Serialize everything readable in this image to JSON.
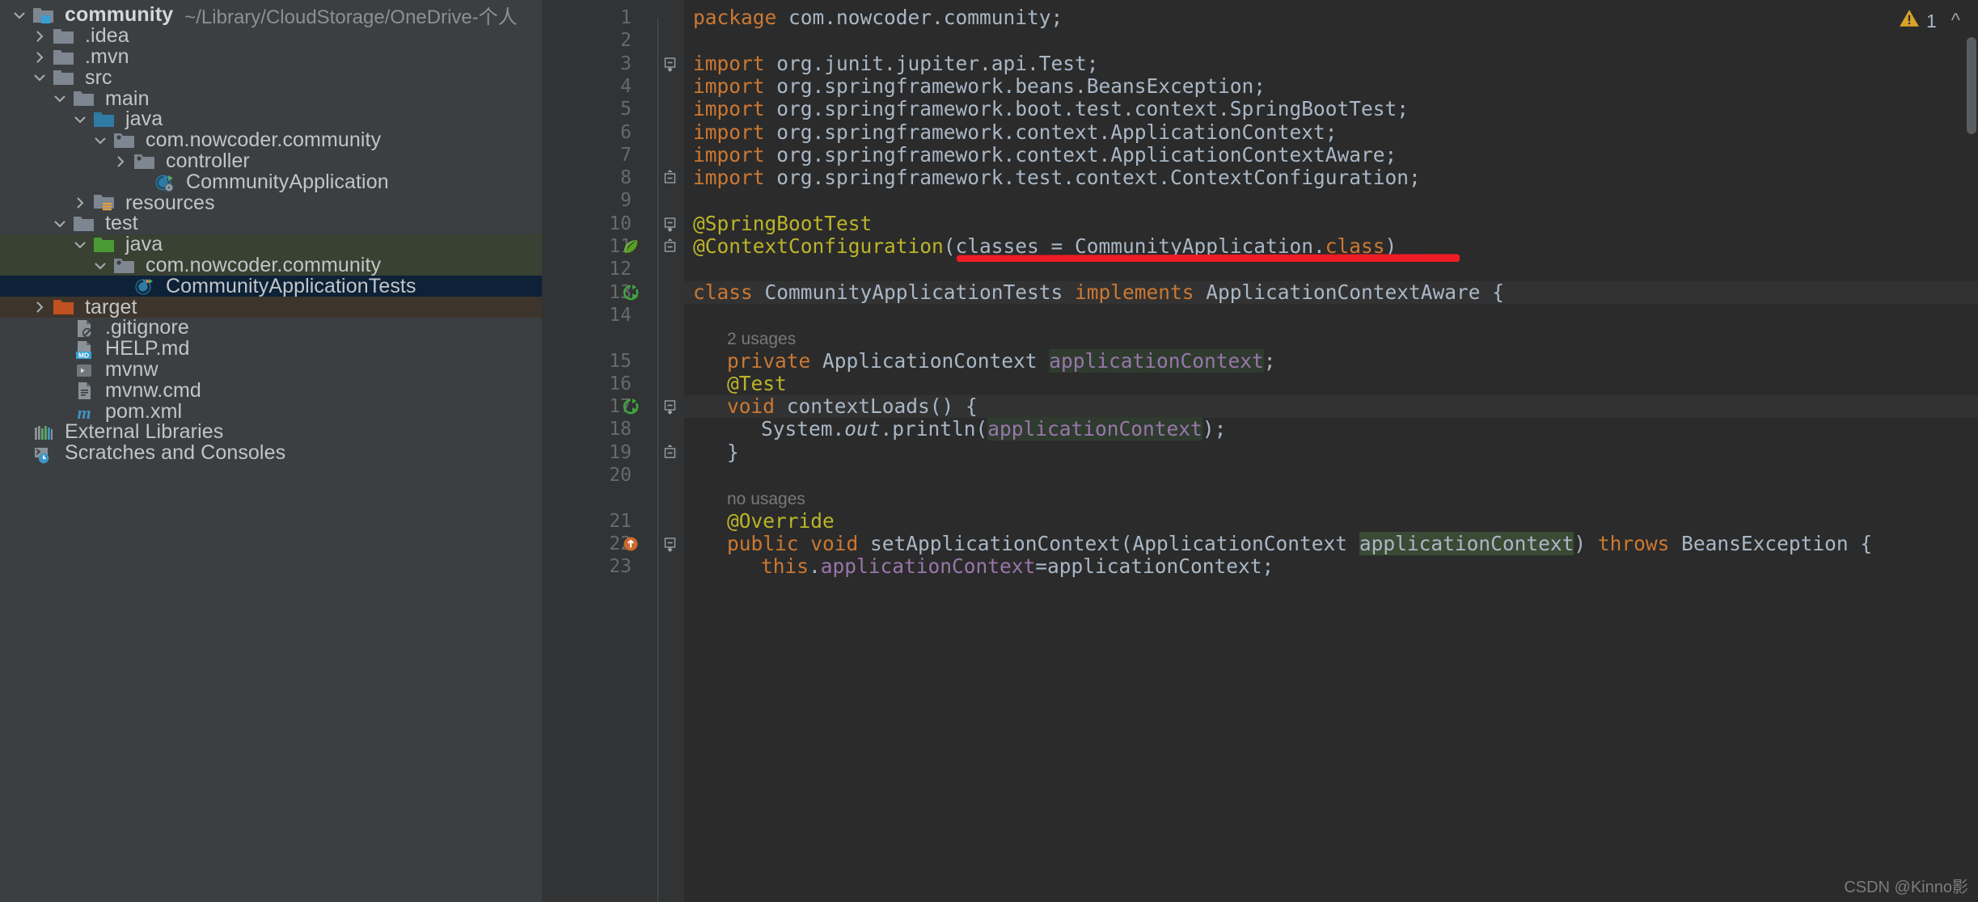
{
  "window": {
    "project_name": "community",
    "project_path": "~/Library/CloudStorage/OneDrive-个人"
  },
  "sidebar": {
    "items": [
      {
        "label": "community",
        "path": "~/Library/CloudStorage/OneDrive-个人",
        "icon": "module-folder-icon",
        "indent": 0,
        "arrow": "down",
        "state": "normal",
        "bold": true
      },
      {
        "label": ".idea",
        "path": "",
        "icon": "folder-icon",
        "indent": 1,
        "arrow": "right",
        "state": "normal",
        "bold": false
      },
      {
        "label": ".mvn",
        "path": "",
        "icon": "folder-icon",
        "indent": 1,
        "arrow": "right",
        "state": "normal",
        "bold": false
      },
      {
        "label": "src",
        "path": "",
        "icon": "folder-icon",
        "indent": 1,
        "arrow": "down",
        "state": "normal",
        "bold": false
      },
      {
        "label": "main",
        "path": "",
        "icon": "folder-icon",
        "indent": 2,
        "arrow": "down",
        "state": "normal",
        "bold": false
      },
      {
        "label": "java",
        "path": "",
        "icon": "source-root-blue-icon",
        "indent": 3,
        "arrow": "down",
        "state": "normal",
        "bold": false
      },
      {
        "label": "com.nowcoder.community",
        "path": "",
        "icon": "package-icon",
        "indent": 4,
        "arrow": "down",
        "state": "normal",
        "bold": false
      },
      {
        "label": "controller",
        "path": "",
        "icon": "package-icon",
        "indent": 5,
        "arrow": "right",
        "state": "normal",
        "bold": false
      },
      {
        "label": "CommunityApplication",
        "path": "",
        "icon": "spring-class-icon",
        "indent": 6,
        "arrow": "none",
        "state": "normal",
        "bold": false
      },
      {
        "label": "resources",
        "path": "",
        "icon": "resources-folder-icon",
        "indent": 3,
        "arrow": "right",
        "state": "normal",
        "bold": false
      },
      {
        "label": "test",
        "path": "",
        "icon": "folder-icon",
        "indent": 2,
        "arrow": "down",
        "state": "normal",
        "bold": false
      },
      {
        "label": "java",
        "path": "",
        "icon": "test-root-green-icon",
        "indent": 3,
        "arrow": "down",
        "state": "green",
        "bold": false
      },
      {
        "label": "com.nowcoder.community",
        "path": "",
        "icon": "package-icon",
        "indent": 4,
        "arrow": "down",
        "state": "green",
        "bold": false
      },
      {
        "label": "CommunityApplicationTests",
        "path": "",
        "icon": "test-class-icon",
        "indent": 5,
        "arrow": "none",
        "state": "selected",
        "bold": false
      },
      {
        "label": "target",
        "path": "",
        "icon": "excluded-folder-icon",
        "indent": 1,
        "arrow": "right",
        "state": "brown",
        "bold": false
      },
      {
        "label": ".gitignore",
        "path": "",
        "icon": "gitignore-file-icon",
        "indent": 2,
        "arrow": "none",
        "state": "normal",
        "bold": false
      },
      {
        "label": "HELP.md",
        "path": "",
        "icon": "markdown-file-icon",
        "indent": 2,
        "arrow": "none",
        "state": "normal",
        "bold": false
      },
      {
        "label": "mvnw",
        "path": "",
        "icon": "shell-script-icon",
        "indent": 2,
        "arrow": "none",
        "state": "normal",
        "bold": false
      },
      {
        "label": "mvnw.cmd",
        "path": "",
        "icon": "cmd-file-icon",
        "indent": 2,
        "arrow": "none",
        "state": "normal",
        "bold": false
      },
      {
        "label": "pom.xml",
        "path": "",
        "icon": "maven-pom-icon",
        "indent": 2,
        "arrow": "none",
        "state": "normal",
        "bold": false
      },
      {
        "label": "External Libraries",
        "path": "",
        "icon": "external-libraries-icon",
        "indent": 0,
        "arrow": "none",
        "state": "normal",
        "bold": false
      },
      {
        "label": "Scratches and Consoles",
        "path": "",
        "icon": "scratches-icon",
        "indent": 0,
        "arrow": "none",
        "state": "normal",
        "bold": false
      }
    ]
  },
  "editor": {
    "inspection_count": "1",
    "inspection_icon": "warning-triangle-icon",
    "scroll_up_icon": "chevron-up-icon",
    "lines": [
      {
        "num": "1",
        "gutter_icon": "none",
        "fold": "none",
        "indent": 0
      },
      {
        "num": "2",
        "gutter_icon": "none",
        "fold": "none",
        "indent": 0
      },
      {
        "num": "3",
        "gutter_icon": "none",
        "fold": "start",
        "indent": 0
      },
      {
        "num": "4",
        "gutter_icon": "none",
        "fold": "none",
        "indent": 0
      },
      {
        "num": "5",
        "gutter_icon": "none",
        "fold": "none",
        "indent": 0
      },
      {
        "num": "6",
        "gutter_icon": "none",
        "fold": "none",
        "indent": 0
      },
      {
        "num": "7",
        "gutter_icon": "none",
        "fold": "none",
        "indent": 0
      },
      {
        "num": "8",
        "gutter_icon": "none",
        "fold": "end",
        "indent": 0
      },
      {
        "num": "9",
        "gutter_icon": "none",
        "fold": "none",
        "indent": 0
      },
      {
        "num": "10",
        "gutter_icon": "none",
        "fold": "start",
        "indent": 0
      },
      {
        "num": "11",
        "gutter_icon": "spring-leaf-icon",
        "fold": "end",
        "indent": 0
      },
      {
        "num": "12",
        "gutter_icon": "none",
        "fold": "none",
        "indent": 0
      },
      {
        "num": "13",
        "gutter_icon": "run-test-icon",
        "fold": "none",
        "indent": 0
      },
      {
        "num": "14",
        "gutter_icon": "none",
        "fold": "none",
        "indent": 0
      },
      {
        "num": "",
        "gutter_icon": "none",
        "fold": "none",
        "indent": 0
      },
      {
        "num": "15",
        "gutter_icon": "none",
        "fold": "none",
        "indent": 0
      },
      {
        "num": "16",
        "gutter_icon": "none",
        "fold": "none",
        "indent": 0
      },
      {
        "num": "17",
        "gutter_icon": "run-test-icon",
        "fold": "start",
        "indent": 0
      },
      {
        "num": "18",
        "gutter_icon": "none",
        "fold": "none",
        "indent": 0
      },
      {
        "num": "19",
        "gutter_icon": "none",
        "fold": "end",
        "indent": 0
      },
      {
        "num": "20",
        "gutter_icon": "none",
        "fold": "none",
        "indent": 0
      },
      {
        "num": "",
        "gutter_icon": "none",
        "fold": "none",
        "indent": 0
      },
      {
        "num": "21",
        "gutter_icon": "none",
        "fold": "none",
        "indent": 0
      },
      {
        "num": "22",
        "gutter_icon": "override-icon",
        "fold": "start",
        "indent": 0
      },
      {
        "num": "23",
        "gutter_icon": "none",
        "fold": "none",
        "indent": 0
      }
    ],
    "code": {
      "l1_package_kw": "package",
      "l1_package_name": " com.nowcoder.community;",
      "l3_import": "import",
      "l3_rest": " org.junit.jupiter.api.",
      "l3_cls": "Test",
      "l3_semi": ";",
      "l4_rest": " org.springframework.beans.BeansException;",
      "l5_rest": " org.springframework.boot.test.context.",
      "l5_cls": "SpringBootTest",
      "l5_semi": ";",
      "l6_rest": " org.springframework.context.ApplicationContext;",
      "l7_rest": " org.springframework.context.ApplicationContextAware;",
      "l8_rest": " org.springframework.test.context.",
      "l8_cls": "ContextConfiguration",
      "l8_semi": ";",
      "l10_ann": "@SpringBootTest",
      "l11_ann": "@ContextConfiguration",
      "l11_open": "(classes = CommunityApplication.",
      "l11_class_kw": "class",
      "l11_close": ")",
      "l13_class_kw": "class",
      "l13_name": " CommunityApplicationTests ",
      "l13_implements": "implements",
      "l13_iface": " ApplicationContextAware {",
      "hint_2usages": "2 usages",
      "hint_nousages": "no usages",
      "l15_private": "private",
      "l15_type": " ApplicationContext ",
      "l15_field": "applicationContext",
      "l15_semi": ";",
      "l16_ann": "@Test",
      "l17_void": "void",
      "l17_method": " contextLoads",
      "l17_sig": "() {",
      "l18_system": "System.",
      "l18_out": "out",
      "l18_println": ".println(",
      "l18_arg": "applicationContext",
      "l18_end": ");",
      "l19_brace": "}",
      "l21_ann": "@Override",
      "l22_public": "public",
      "l22_void": " void",
      "l22_method": " setApplicationContext",
      "l22_params_open": "(ApplicationContext ",
      "l22_param": "applicationContext",
      "l22_params_close": ") ",
      "l22_throws": "throws",
      "l22_exc": " BeansException {",
      "l23_this": "this",
      "l23_dot": ".",
      "l23_field": "applicationContext",
      "l23_assign": "=applicationContext;"
    }
  },
  "watermark": "CSDN @Kinno影",
  "colors": {
    "sidebar_bg": "#3c3f41",
    "editor_bg": "#2b2b2b",
    "gutter_bg": "#313335",
    "selection_blue": "#0d2137",
    "selection_green": "#384132",
    "selection_brown": "#3d352c",
    "annotation": "#bbb529",
    "keyword": "#cc7832",
    "identifier": "#a9b7c6",
    "field": "#9876aa",
    "red_underline": "#ee1c25",
    "tab_accent": "#4a88c7"
  }
}
